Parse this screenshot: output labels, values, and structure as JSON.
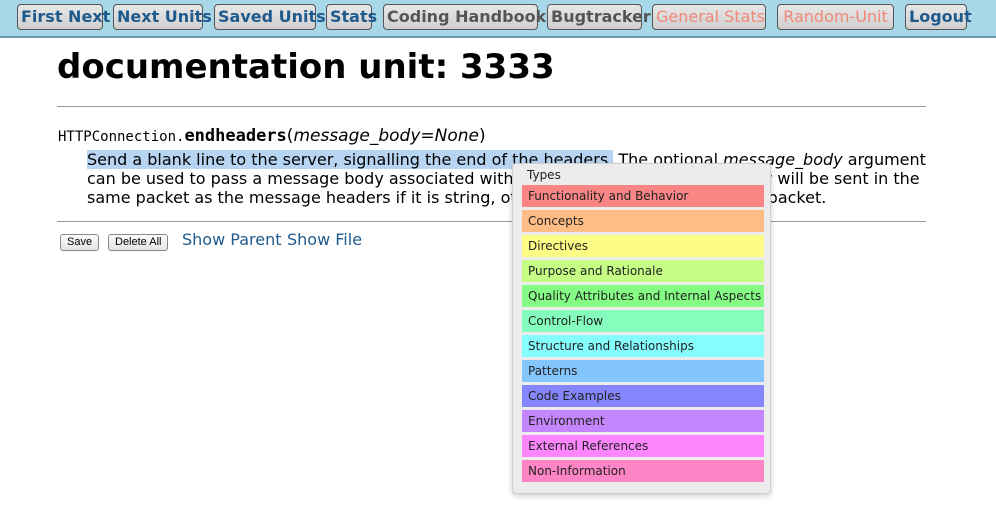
{
  "nav": [
    {
      "label": "First Next",
      "style": "blue"
    },
    {
      "label": "Next Units",
      "style": "blue"
    },
    {
      "label": "Saved Units",
      "style": "blue"
    },
    {
      "label": "Stats",
      "style": "blue"
    },
    {
      "label": "Coding Handbook",
      "style": "gray"
    },
    {
      "label": "Bugtracker",
      "style": "gray"
    },
    {
      "label": "General Stats",
      "style": "red"
    },
    {
      "label": "Random-Unit",
      "style": "red"
    },
    {
      "label": "Logout",
      "style": "blue"
    }
  ],
  "title": "documentation unit: 3333",
  "signature": {
    "class_part": "HTTPConnection.",
    "method": "endheaders",
    "open_paren": "(",
    "param": "message_body=None",
    "close_paren": ")"
  },
  "description": {
    "line1_highlight": "Send a blank line to the server, signalling the end of the headers.",
    "line1_rest_pre": " The optional ",
    "line1_em": "message_body",
    "line1_rest_post": " argument",
    "line2": "can be used to pass a message body associated with the request. The message body will be sent in the",
    "line3": "same packet as the message headers if it is string, otherwise it is sent in a separate packet."
  },
  "buttons": {
    "save": "Save",
    "delete_all": "Delete All"
  },
  "links": {
    "show_parent": "Show Parent",
    "show_file": "Show File"
  },
  "popup": {
    "title": "Types",
    "items": [
      {
        "label": "Functionality and Behavior",
        "color": "#f98585"
      },
      {
        "label": "Concepts",
        "color": "#fdbd85"
      },
      {
        "label": "Directives",
        "color": "#fdfd85"
      },
      {
        "label": "Purpose and Rationale",
        "color": "#c5fd85"
      },
      {
        "label": "Quality Attributes and Internal Aspects",
        "color": "#85fd85"
      },
      {
        "label": "Control-Flow",
        "color": "#85fdbd"
      },
      {
        "label": "Structure and Relationships",
        "color": "#85fdfd"
      },
      {
        "label": "Patterns",
        "color": "#85c5fd"
      },
      {
        "label": "Code Examples",
        "color": "#8585fd"
      },
      {
        "label": "Environment",
        "color": "#c585fd"
      },
      {
        "label": "External References",
        "color": "#fd85fd"
      },
      {
        "label": "Non-Information",
        "color": "#fd85c5"
      }
    ]
  }
}
